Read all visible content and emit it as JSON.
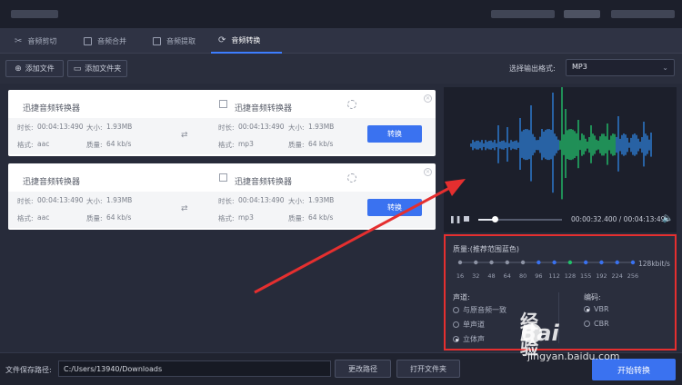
{
  "tabs": [
    {
      "label": "音频剪切",
      "icon": "scissors-icon"
    },
    {
      "label": "音频合并",
      "icon": "merge-icon"
    },
    {
      "label": "音频提取",
      "icon": "extract-icon"
    },
    {
      "label": "音频转换",
      "icon": "convert-icon",
      "active": true
    }
  ],
  "toolbar": {
    "add_file": "添加文件",
    "add_folder": "添加文件夹",
    "format_label": "选择输出格式:",
    "format_value": "MP3"
  },
  "files": [
    {
      "src_name": "迅捷音频转换器",
      "src_duration_label": "时长:",
      "src_duration": "00:04:13:490",
      "src_size_label": "大小:",
      "src_size": "1.93MB",
      "src_format_label": "格式:",
      "src_format": "aac",
      "src_quality_label": "质量:",
      "src_quality": "64 kb/s",
      "dst_name": "迅捷音频转换器",
      "dst_duration_label": "时长:",
      "dst_duration": "00:04:13:490",
      "dst_size_label": "大小:",
      "dst_size": "1.93MB",
      "dst_format_label": "格式:",
      "dst_format": "mp3",
      "dst_quality_label": "质量:",
      "dst_quality": "64 kb/s",
      "convert": "转换"
    },
    {
      "src_name": "迅捷音频转换器",
      "src_duration_label": "时长:",
      "src_duration": "00:04:13:490",
      "src_size_label": "大小:",
      "src_size": "1.93MB",
      "src_format_label": "格式:",
      "src_format": "aac",
      "src_quality_label": "质量:",
      "src_quality": "64 kb/s",
      "dst_name": "迅捷音频转换器",
      "dst_duration_label": "时长:",
      "dst_duration": "00:04:13:490",
      "dst_size_label": "大小:",
      "dst_size": "1.93MB",
      "dst_format_label": "格式:",
      "dst_format": "mp3",
      "dst_quality_label": "质量:",
      "dst_quality": "64 kb/s",
      "convert": "转换"
    }
  ],
  "player": {
    "time": "00:00:32.400 / 00:04:13:490",
    "progress": 0.2
  },
  "params": {
    "quality_label": "质量:(推荐范围蓝色)",
    "quality_ticks": [
      "16",
      "32",
      "48",
      "64",
      "80",
      "96",
      "112",
      "128",
      "155",
      "192",
      "224",
      "256"
    ],
    "quality_selected": "128",
    "quality_unit": "128kbit/s",
    "channel_label": "声道:",
    "channels": [
      {
        "label": "与原音频一致",
        "on": false
      },
      {
        "label": "单声道",
        "on": false
      },
      {
        "label": "立体声",
        "on": true
      }
    ],
    "encode_label": "编码:",
    "encodes": [
      {
        "label": "VBR",
        "on": true
      },
      {
        "label": "CBR",
        "on": false
      }
    ]
  },
  "footer": {
    "save_label": "文件保存路径:",
    "path": "C:/Users/13940/Downloads",
    "change_path": "更改路径",
    "open_folder": "打开文件夹",
    "start": "开始转换"
  },
  "watermark": {
    "brand": "Bai",
    "brand2": "经验",
    "url": "jingyan.baidu.com"
  },
  "colors": {
    "accent": "#3a72f0",
    "highlight": "#e52f2f",
    "wave_blue": "#2f7fd8",
    "wave_green": "#22c06a"
  }
}
